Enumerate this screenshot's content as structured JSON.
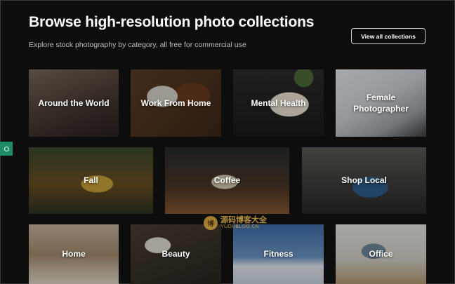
{
  "header": {
    "title": "Browse high-resolution photo collections",
    "subtitle": "Explore stock photography by category, all free for commercial use",
    "view_all_label": "View all collections"
  },
  "collections": [
    {
      "label": "Around the World"
    },
    {
      "label": "Work From Home"
    },
    {
      "label": "Mental Health"
    },
    {
      "label": "Female Photographer"
    },
    {
      "label": "Fall"
    },
    {
      "label": "Coffee"
    },
    {
      "label": "Shop Local"
    },
    {
      "label": "Home"
    },
    {
      "label": "Beauty"
    },
    {
      "label": "Fitness"
    },
    {
      "label": "Office"
    }
  ],
  "watermark": {
    "badge": "博",
    "text": "源码博客大全",
    "url": "YUOUBLOG.CN"
  },
  "colors": {
    "background": "#0d0d0d",
    "side_tab": "#1f8a63"
  }
}
